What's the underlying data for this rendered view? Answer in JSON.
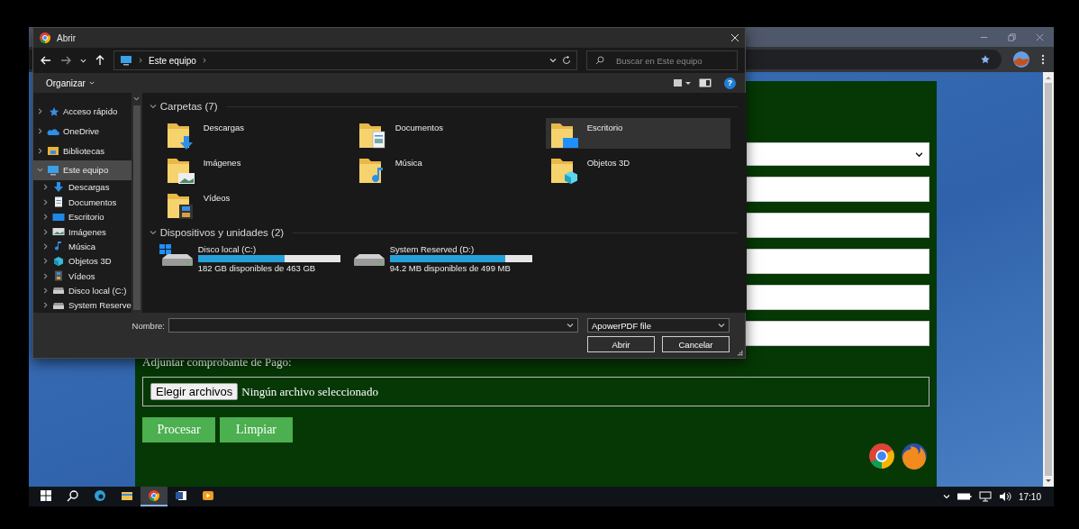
{
  "browser": {
    "window_controls": [
      {
        "kind": "minimize"
      },
      {
        "kind": "restore"
      },
      {
        "kind": "close"
      }
    ]
  },
  "form": {
    "select": {
      "expanded": false
    },
    "inputs": [
      {
        "kind": "text"
      },
      {
        "kind": "text"
      },
      {
        "kind": "text"
      },
      {
        "kind": "text"
      },
      {
        "kind": "text"
      }
    ],
    "attachment_label": "Adjuntar comprobante de Pago:",
    "file_button": "Elegir archivos",
    "file_status": "Ningún archivo seleccionado",
    "buttons": [
      "Procesar",
      "Limpiar"
    ]
  },
  "dialog": {
    "title": "Abrir",
    "breadcrumb": [
      "Este equipo"
    ],
    "search": {
      "placeholder": "Buscar en Este equipo"
    },
    "toolbar": {
      "organize": "Organizar",
      "help": "?"
    },
    "nav": [
      {
        "label": "Acceso rápido",
        "kind": "star",
        "expanded": false,
        "selected": false
      },
      {
        "label": "OneDrive",
        "kind": "cloud",
        "expanded": false,
        "selected": false
      },
      {
        "label": "Bibliotecas",
        "kind": "library",
        "expanded": false,
        "selected": false
      },
      {
        "label": "Este equipo",
        "kind": "pc",
        "expanded": true,
        "selected": true,
        "children": [
          {
            "label": "Descargas",
            "kind": "download",
            "expanded": false,
            "selected": false
          },
          {
            "label": "Documentos",
            "kind": "document",
            "expanded": false,
            "selected": false
          },
          {
            "label": "Escritorio",
            "kind": "desktop",
            "expanded": false,
            "selected": false
          },
          {
            "label": "Imágenes",
            "kind": "pictures",
            "expanded": false,
            "selected": false
          },
          {
            "label": "Música",
            "kind": "music",
            "expanded": false,
            "selected": false
          },
          {
            "label": "Objetos 3D",
            "kind": "objects3d",
            "expanded": false,
            "selected": false
          },
          {
            "label": "Vídeos",
            "kind": "videos",
            "expanded": false,
            "selected": false
          },
          {
            "label": "Disco local (C:)",
            "kind": "drive",
            "expanded": false,
            "selected": false
          },
          {
            "label": "System Reserve",
            "kind": "drive",
            "expanded": false,
            "selected": false
          }
        ]
      }
    ],
    "folders": {
      "title": "Carpetas (7)",
      "expanded": true,
      "items": [
        {
          "label": "Descargas",
          "kind": "download",
          "selected": false
        },
        {
          "label": "Documentos",
          "kind": "document",
          "selected": false
        },
        {
          "label": "Escritorio",
          "kind": "desktop",
          "selected": true
        },
        {
          "label": "Imágenes",
          "kind": "pictures",
          "selected": false
        },
        {
          "label": "Música",
          "kind": "music",
          "selected": false
        },
        {
          "label": "Objetos 3D",
          "kind": "objects3d",
          "selected": false
        },
        {
          "label": "Vídeos",
          "kind": "videos",
          "selected": false
        }
      ]
    },
    "drives": {
      "title": "Dispositivos y unidades (2)",
      "expanded": true,
      "items": [
        {
          "name": "Disco local (C:)",
          "kind": "system",
          "level": 0.61,
          "reading": "182 GB disponibles de 463 GB"
        },
        {
          "name": "System Reserved (D:)",
          "kind": "plain",
          "level": 0.81,
          "reading": "94.2 MB disponibles de 499 MB"
        }
      ]
    },
    "filename": {
      "label": "Nombre:"
    },
    "filetype": "ApowerPDF file",
    "buttons": [
      "Abrir",
      "Cancelar"
    ]
  },
  "taskbar": {
    "apps": [
      {
        "kind": "start",
        "selected": false
      },
      {
        "kind": "search",
        "selected": false
      },
      {
        "kind": "edge",
        "selected": false
      },
      {
        "kind": "explorer",
        "selected": false
      },
      {
        "kind": "chrome",
        "selected": true
      },
      {
        "kind": "word",
        "selected": false
      },
      {
        "kind": "media",
        "selected": false
      }
    ],
    "time": "17:10"
  }
}
